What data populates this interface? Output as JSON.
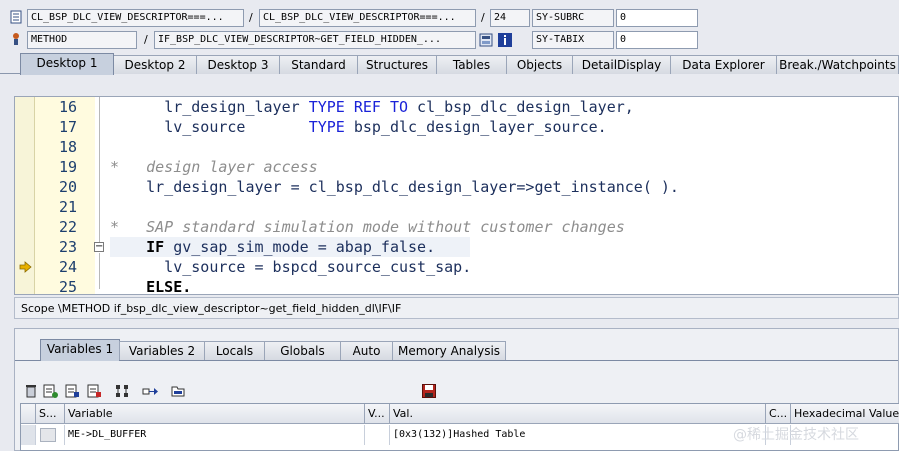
{
  "header": {
    "row1": {
      "field1": "CL_BSP_DLC_VIEW_DESCRIPTOR===...",
      "sep1": "/",
      "field2": "CL_BSP_DLC_VIEW_DESCRIPTOR===...",
      "sep2": "/",
      "line_no": "24",
      "sysvar_name": "SY-SUBRC",
      "sysvar_value": "0"
    },
    "row2": {
      "field1": "METHOD",
      "sep1": "/",
      "field2": "IF_BSP_DLC_VIEW_DESCRIPTOR~GET_FIELD_HIDDEN_...",
      "sysvar_name": "SY-TABIX",
      "sysvar_value": "0"
    }
  },
  "tabs": [
    "Desktop 1",
    "Desktop 2",
    "Desktop 3",
    "Standard",
    "Structures",
    "Tables",
    "Objects",
    "DetailDisplay",
    "Data Explorer",
    "Break./Watchpoints"
  ],
  "code": {
    "lines": [
      {
        "no": "16",
        "parts": [
          {
            "t": "lr_design_layer ",
            "c": ""
          },
          {
            "t": "TYPE REF TO",
            "c": "kw"
          },
          {
            "t": " cl_bsp_dlc_design_layer,",
            "c": ""
          }
        ],
        "indent": "  "
      },
      {
        "no": "17",
        "parts": [
          {
            "t": "lv_source       ",
            "c": ""
          },
          {
            "t": "TYPE",
            "c": "kw"
          },
          {
            "t": " bsp_dlc_design_layer_source.",
            "c": ""
          }
        ],
        "indent": "  "
      },
      {
        "no": "18",
        "parts": [],
        "indent": ""
      },
      {
        "no": "19",
        "parts": [
          {
            "t": "*   design layer access",
            "c": "cmt"
          }
        ],
        "indent": ""
      },
      {
        "no": "20",
        "parts": [
          {
            "t": "    lr_design_layer = cl_bsp_dlc_design_layer=>get_instance( ).",
            "c": ""
          }
        ],
        "indent": ""
      },
      {
        "no": "21",
        "parts": [],
        "indent": ""
      },
      {
        "no": "22",
        "parts": [
          {
            "t": "*   SAP standard simulation mode without customer changes",
            "c": "cmt"
          }
        ],
        "indent": ""
      },
      {
        "no": "23",
        "parts": [
          {
            "t": "    ",
            "c": ""
          },
          {
            "t": "IF",
            "c": "kwb"
          },
          {
            "t": " gv_sap_sim_mode = abap_false.",
            "c": ""
          }
        ],
        "indent": ""
      },
      {
        "no": "24",
        "parts": [
          {
            "t": "      lv_source = bspcd_source_cust_sap.",
            "c": ""
          }
        ],
        "indent": ""
      },
      {
        "no": "25",
        "parts": [
          {
            "t": "    ",
            "c": ""
          },
          {
            "t": "ELSE.",
            "c": "kwb"
          }
        ],
        "indent": ""
      }
    ]
  },
  "scope_text": "Scope \\METHOD if_bsp_dlc_view_descriptor~get_field_hidden_dl\\IF\\IF",
  "var_tabs": [
    "Variables 1",
    "Variables 2",
    "Locals",
    "Globals",
    "Auto",
    "Memory Analysis"
  ],
  "grid": {
    "headers": [
      "S...",
      "Variable",
      "V...",
      "Val.",
      "C...",
      "Hexadecimal Value"
    ],
    "rows": [
      {
        "variable": "ME->DL_BUFFER",
        "value": "[0x3(132)]Hashed Table"
      }
    ]
  },
  "watermark": "@稀土掘金技术社区",
  "colors": {
    "keyword": "#1a22d8",
    "comment": "#8d8d8d",
    "line_numbers": "#1c3e6e",
    "current_line_arrow": "#e8b000"
  }
}
